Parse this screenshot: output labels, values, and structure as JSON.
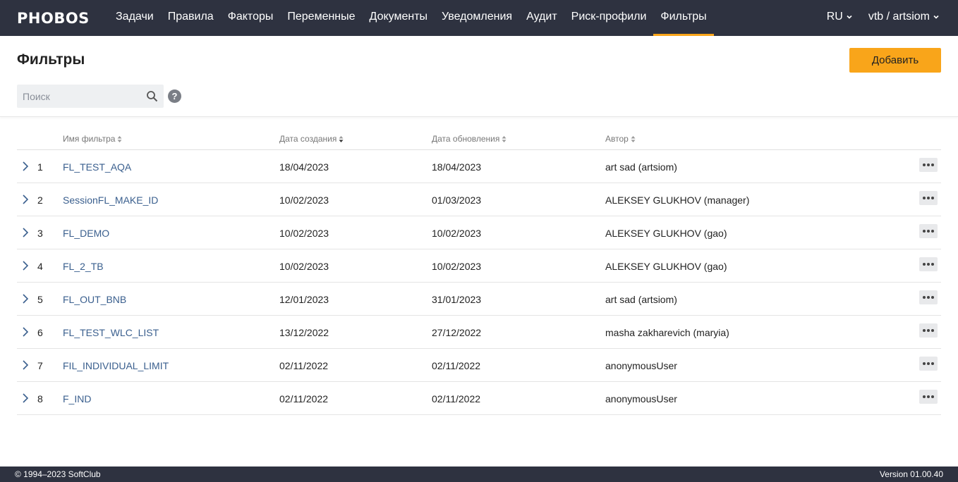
{
  "app": {
    "logo": "PHOBOS"
  },
  "nav": {
    "items": [
      {
        "label": "Задачи"
      },
      {
        "label": "Правила"
      },
      {
        "label": "Факторы"
      },
      {
        "label": "Переменные"
      },
      {
        "label": "Документы"
      },
      {
        "label": "Уведомления"
      },
      {
        "label": "Аудит"
      },
      {
        "label": "Риск-профили"
      },
      {
        "label": "Фильтры",
        "active": true
      }
    ],
    "language": "RU",
    "user": "vtb / artsiom"
  },
  "page": {
    "title": "Фильтры",
    "add_label": "Добавить",
    "search_placeholder": "Поиск",
    "search_value": "",
    "help": "?"
  },
  "table": {
    "columns": {
      "name": "Имя фильтра",
      "created": "Дата создания",
      "updated": "Дата обновления",
      "author": "Автор"
    },
    "rows": [
      {
        "index": "1",
        "name": "FL_TEST_AQA",
        "created": "18/04/2023",
        "updated": "18/04/2023",
        "author": "art sad (artsiom)"
      },
      {
        "index": "2",
        "name": "SessionFL_MAKE_ID",
        "created": "10/02/2023",
        "updated": "01/03/2023",
        "author": "ALEKSEY GLUKHOV (manager)"
      },
      {
        "index": "3",
        "name": "FL_DEMO",
        "created": "10/02/2023",
        "updated": "10/02/2023",
        "author": "ALEKSEY GLUKHOV (gao)"
      },
      {
        "index": "4",
        "name": "FL_2_TB",
        "created": "10/02/2023",
        "updated": "10/02/2023",
        "author": "ALEKSEY GLUKHOV (gao)"
      },
      {
        "index": "5",
        "name": "FL_OUT_BNB",
        "created": "12/01/2023",
        "updated": "31/01/2023",
        "author": "art sad (artsiom)"
      },
      {
        "index": "6",
        "name": "FL_TEST_WLC_LIST",
        "created": "13/12/2022",
        "updated": "27/12/2022",
        "author": "masha zakharevich (maryia)"
      },
      {
        "index": "7",
        "name": "FIL_INDIVIDUAL_LIMIT",
        "created": "02/11/2022",
        "updated": "02/11/2022",
        "author": "anonymousUser"
      },
      {
        "index": "8",
        "name": "F_IND",
        "created": "02/11/2022",
        "updated": "02/11/2022",
        "author": "anonymousUser"
      }
    ]
  },
  "footer": {
    "copyright": "© 1994–2023 SoftClub",
    "version": "Version 01.00.40"
  },
  "colors": {
    "topbar": "#2e3240",
    "accent": "#f9a51a",
    "link": "#3a5f8e"
  },
  "icons": {
    "search": "search-icon",
    "help": "help-icon",
    "expand": "chevron-right-icon",
    "more": "more-horizontal-icon",
    "dropdown": "chevron-down-icon",
    "sort": "sort-icon"
  }
}
